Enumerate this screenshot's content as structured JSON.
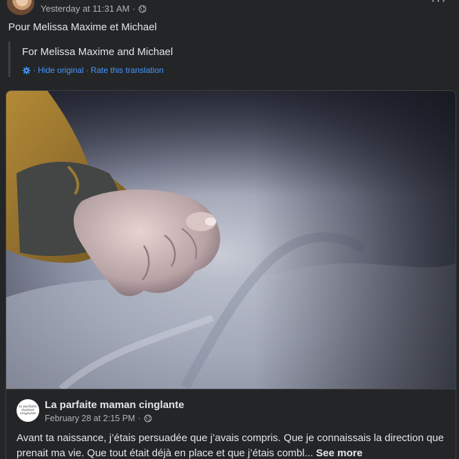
{
  "post": {
    "timestamp": "Yesterday at 11:31 AM",
    "separator": "·",
    "privacy_icon": "globe-icon",
    "more_icon": "more-dots-icon",
    "more_label": "···",
    "caption": "Pour Melissa Maxime et Michael",
    "translation": {
      "text": "For Melissa Maxime and Michael",
      "settings_icon": "gear-icon",
      "dot": "·",
      "hide_original": "Hide original",
      "rate": "Rate this translation"
    }
  },
  "shared": {
    "image_subject": "baby-hand-photo",
    "page_name": "La parfaite maman cinglante",
    "logo_text": "la parfaite maman cinglante",
    "date": "February 28 at 2:15 PM",
    "separator": "·",
    "privacy_icon": "globe-icon",
    "text": "Avant ta naissance, j’étais persuadée que j’avais compris. Que je connaissais la direction que prenait ma vie. Que tout était déjà en place et que j’étais combl...",
    "see_more": "See more"
  },
  "colors": {
    "background": "#242526",
    "primary_text": "#e4e6eb",
    "secondary_text": "#b0b3b8",
    "link": "#4599ff",
    "border": "#3e4042"
  }
}
